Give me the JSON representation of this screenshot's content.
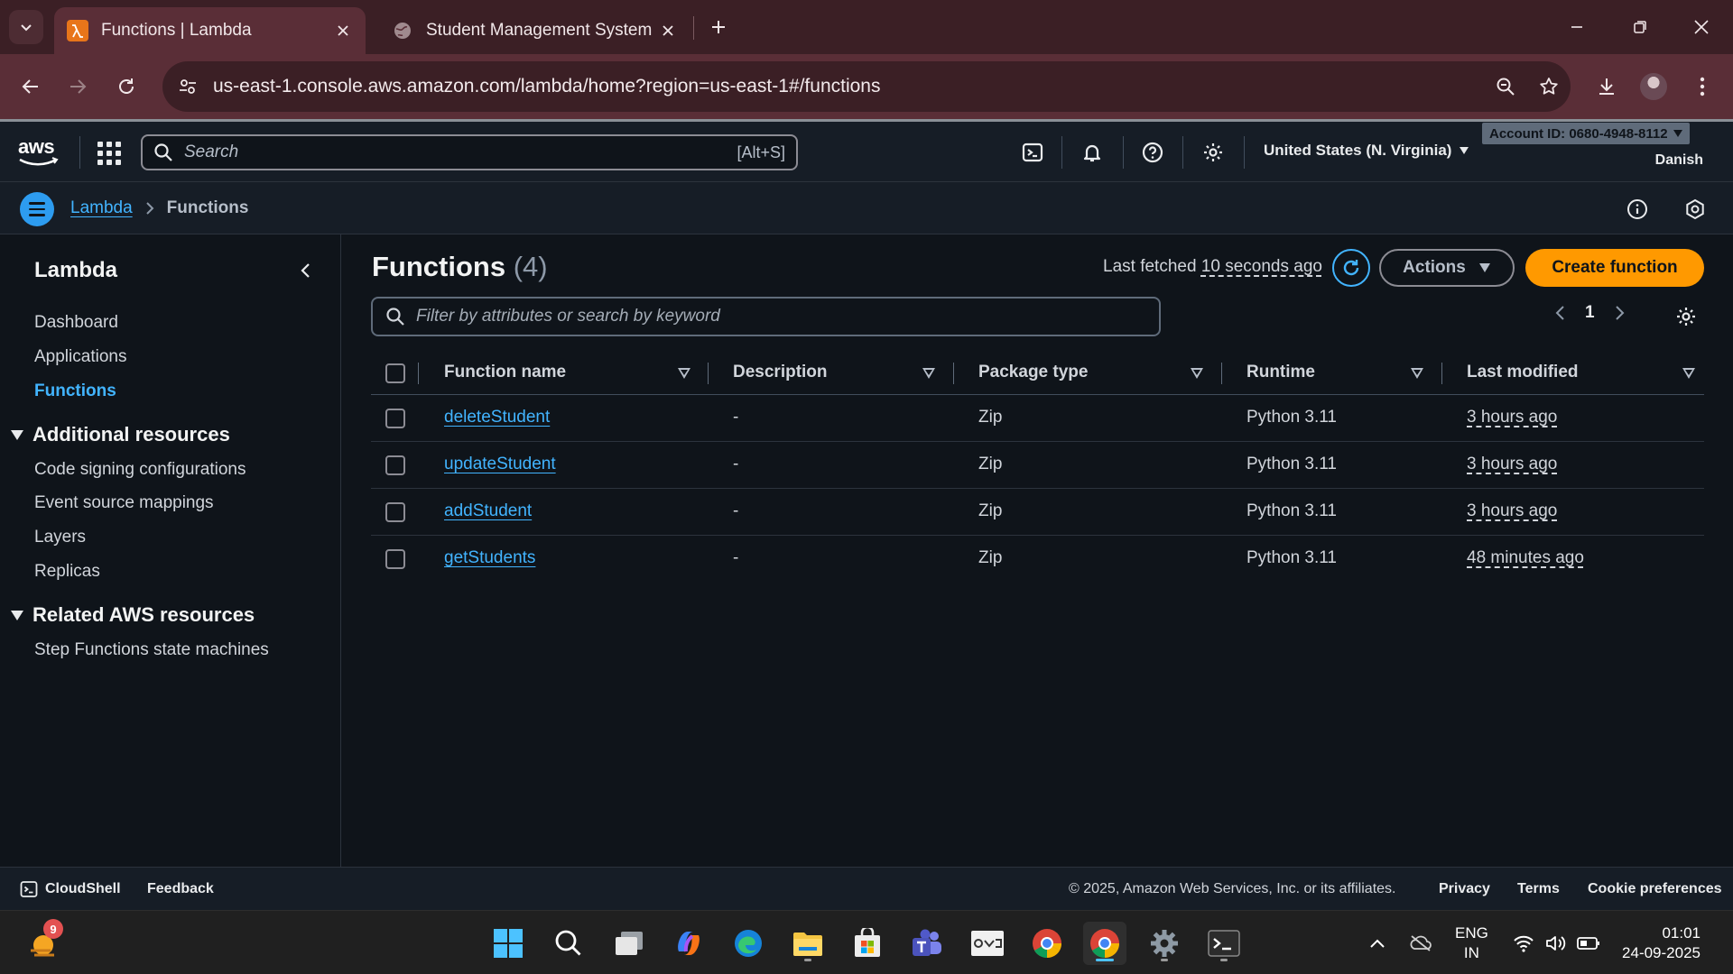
{
  "browser": {
    "tabs": [
      {
        "title": "Functions | Lambda"
      },
      {
        "title": "Student Management System"
      }
    ],
    "url": "us-east-1.console.aws.amazon.com/lambda/home?region=us-east-1#/functions"
  },
  "aws_nav": {
    "logo": "aws",
    "search_placeholder": "Search",
    "search_shortcut": "[Alt+S]",
    "region": "United States (N. Virginia)",
    "account": "Account ID: 0680-4948-8112",
    "user": "Danish"
  },
  "breadcrumb": {
    "service": "Lambda",
    "current": "Functions"
  },
  "sidebar": {
    "title": "Lambda",
    "items": [
      "Dashboard",
      "Applications",
      "Functions"
    ],
    "active_item": "Functions",
    "sections": [
      {
        "title": "Additional resources",
        "items": [
          "Code signing configurations",
          "Event source mappings",
          "Layers",
          "Replicas"
        ]
      },
      {
        "title": "Related AWS resources",
        "items": [
          "Step Functions state machines"
        ]
      }
    ]
  },
  "main": {
    "title": "Functions",
    "count": "(4)",
    "last_fetched_label": "Last fetched",
    "last_fetched_value": "10 seconds ago",
    "actions_label": "Actions",
    "create_label": "Create function",
    "filter_placeholder": "Filter by attributes or search by keyword",
    "page": "1"
  },
  "table": {
    "columns": [
      "Function name",
      "Description",
      "Package type",
      "Runtime",
      "Last modified"
    ],
    "rows": [
      {
        "name": "deleteStudent",
        "description": "-",
        "package": "Zip",
        "runtime": "Python 3.11",
        "modified": "3 hours ago"
      },
      {
        "name": "updateStudent",
        "description": "-",
        "package": "Zip",
        "runtime": "Python 3.11",
        "modified": "3 hours ago"
      },
      {
        "name": "addStudent",
        "description": "-",
        "package": "Zip",
        "runtime": "Python 3.11",
        "modified": "3 hours ago"
      },
      {
        "name": "getStudents",
        "description": "-",
        "package": "Zip",
        "runtime": "Python 3.11",
        "modified": "48 minutes ago"
      }
    ]
  },
  "footer": {
    "cloudshell": "CloudShell",
    "feedback": "Feedback",
    "copyright": "© 2025, Amazon Web Services, Inc. or its affiliates.",
    "privacy": "Privacy",
    "terms": "Terms",
    "cookies": "Cookie preferences"
  },
  "taskbar": {
    "weather_badge": "9",
    "lang_line1": "ENG",
    "lang_line2": "IN",
    "time": "01:01",
    "date": "24-09-2025"
  },
  "colors": {
    "accent_blue": "#42b4ff",
    "aws_orange": "#ff9900",
    "bg": "#0f141a",
    "browser_frame": "#5a2e37"
  }
}
